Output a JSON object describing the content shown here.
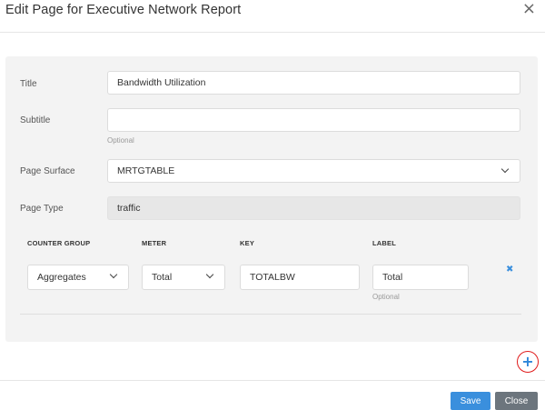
{
  "modal": {
    "title": "Edit Page for Executive Network Report",
    "close_icon": "close-icon"
  },
  "form": {
    "title": {
      "label": "Title",
      "value": "Bandwidth Utilization"
    },
    "subtitle": {
      "label": "Subtitle",
      "value": "",
      "hint": "Optional"
    },
    "page_surface": {
      "label": "Page Surface",
      "value": "MRTGTABLE"
    },
    "page_type": {
      "label": "Page Type",
      "value": "traffic"
    }
  },
  "counters": {
    "headers": {
      "counter_group": "COUNTER GROUP",
      "meter": "METER",
      "key": "KEY",
      "label": "LABEL"
    },
    "rows": [
      {
        "counter_group": "Aggregates",
        "meter": "Total",
        "key": "TOTALBW",
        "label": "Total",
        "label_hint": "Optional",
        "remove_icon": "remove-icon"
      }
    ],
    "add_icon": "plus-icon"
  },
  "footer": {
    "save_label": "Save",
    "close_label": "Close"
  },
  "colors": {
    "primary": "#3a8fdd",
    "secondary": "#6c757d",
    "highlight_ring": "#e01b1b"
  }
}
